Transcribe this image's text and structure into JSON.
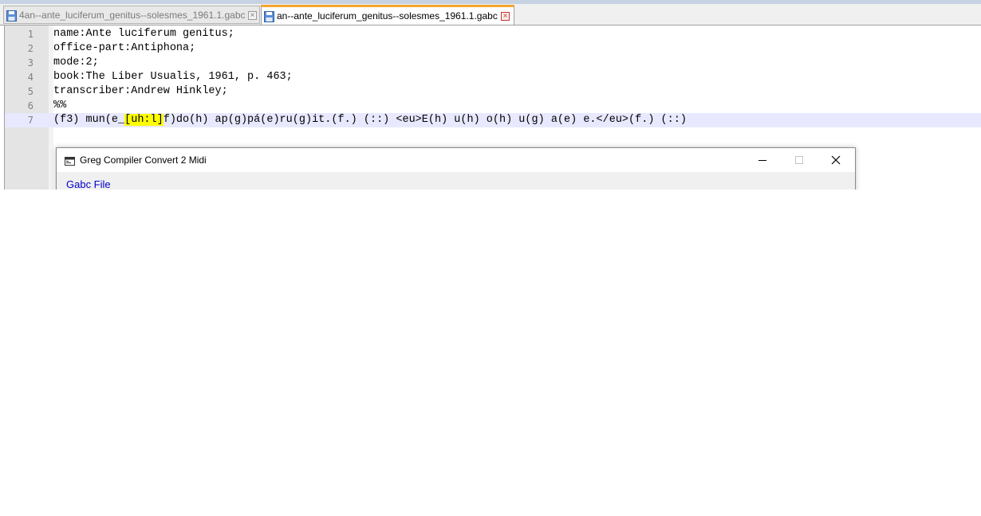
{
  "tabs": [
    {
      "label": "4an--ante_luciferum_genitus--solesmes_1961.1.gabc",
      "icon": "floppy-save-icon",
      "close": "close-tab-icon",
      "active": false
    },
    {
      "label": "an--ante_luciferum_genitus--solesmes_1961.1.gabc",
      "icon": "floppy-save-icon",
      "close": "close-tab-icon",
      "active": true
    }
  ],
  "close_glyph": "×",
  "editor": {
    "lines": [
      {
        "num": "1",
        "text": "name:Ante luciferum genitus;"
      },
      {
        "num": "2",
        "text": "office-part:Antiphona;"
      },
      {
        "num": "3",
        "text": "mode:2;"
      },
      {
        "num": "4",
        "text": "book:The Liber Usualis, 1961, p. 463;"
      },
      {
        "num": "5",
        "text": "transcriber:Andrew Hinkley;"
      },
      {
        "num": "6",
        "text": "%%"
      },
      {
        "num": "7",
        "pre": "(f3) mun(e_",
        "highlight": "[uh:l]",
        "post": "f)do(h) ap(g)pá(e)ru(g)it.(f.) (::) <eu>E(h) u(h) o(h) u(g) a(e) e.</eu>(f.) (::)",
        "current": true
      }
    ]
  },
  "dialog": {
    "title": "Greg Compiler Convert 2 Midi",
    "link": "Gabc File",
    "icon": "app-window-icon"
  },
  "colors": {
    "active_tab_accent": "#f6a72f",
    "current_line": "#e8e8ff",
    "highlight": "#ffff00",
    "link": "#0000cc"
  }
}
